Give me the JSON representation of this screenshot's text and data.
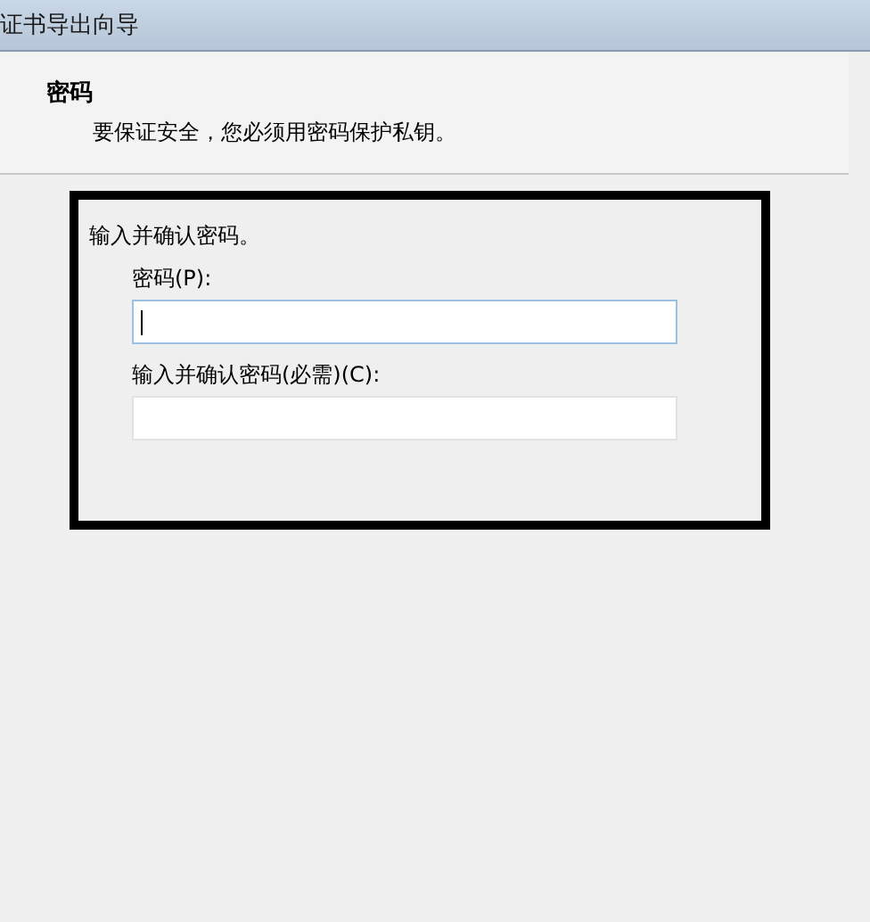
{
  "window": {
    "title": "证书导出向导"
  },
  "header": {
    "title": "密码",
    "subtitle": "要保证安全，您必须用密码保护私钥。"
  },
  "section": {
    "intro": "输入并确认密码。",
    "fields": [
      {
        "label": "密码(P):",
        "focused": true
      },
      {
        "label": "输入并确认密码(必需)(C):",
        "focused": false
      }
    ]
  }
}
